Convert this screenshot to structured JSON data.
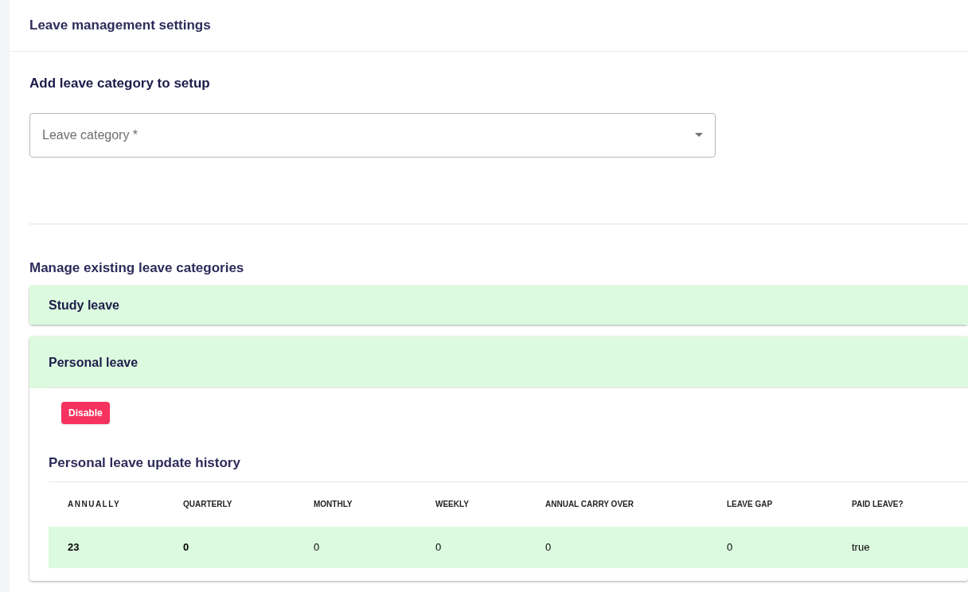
{
  "header": {
    "title": "Leave management settings"
  },
  "add_section": {
    "title": "Add leave category to setup",
    "field": {
      "placeholder": "Leave category *"
    }
  },
  "manage_section": {
    "title": "Manage existing leave categories",
    "categories": [
      {
        "name": "Study leave",
        "expanded": false
      },
      {
        "name": "Personal leave",
        "expanded": true,
        "action": "Disable",
        "history_title": "Personal leave update history",
        "table": {
          "columns": [
            {
              "label": "ANNUALLY",
              "bold": true
            },
            {
              "label": "QUARTERLY",
              "bold": true
            },
            {
              "label": "MONTHLY",
              "bold": false
            },
            {
              "label": "WEEKLY",
              "bold": false
            },
            {
              "label": "ANNUAL CARRY OVER",
              "bold": false
            },
            {
              "label": "LEAVE GAP",
              "bold": false
            },
            {
              "label": "PAID LEAVE?",
              "bold": false
            }
          ],
          "rows": [
            [
              "23",
              "0",
              "0",
              "0",
              "0",
              "0",
              "true"
            ]
          ]
        }
      }
    ]
  }
}
